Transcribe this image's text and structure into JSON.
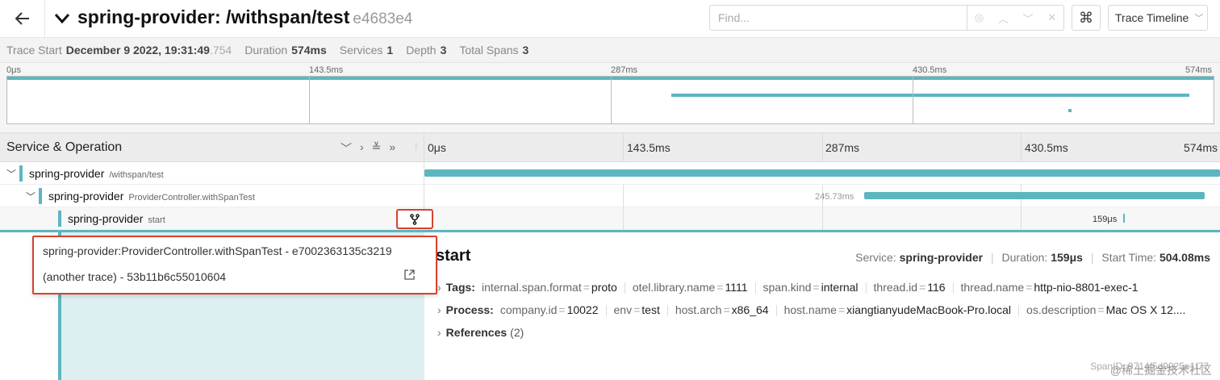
{
  "header": {
    "title": "spring-provider: /withspan/test",
    "trace_id_short": "e4683e4",
    "find_placeholder": "Find...",
    "keyboard_icon": "⌘",
    "view_select": "Trace Timeline"
  },
  "summary": {
    "trace_start_label": "Trace Start",
    "trace_start_value": "December 9 2022, 19:31:49",
    "trace_start_ms": ".754",
    "duration_label": "Duration",
    "duration_value": "574ms",
    "services_label": "Services",
    "services_value": "1",
    "depth_label": "Depth",
    "depth_value": "3",
    "total_spans_label": "Total Spans",
    "total_spans_value": "3"
  },
  "minimap": {
    "ticks": [
      "0μs",
      "143.5ms",
      "287ms",
      "430.5ms",
      "574ms"
    ]
  },
  "columns": {
    "service_op_title": "Service & Operation",
    "ticks": [
      "0μs",
      "143.5ms",
      "287ms",
      "430.5ms",
      "574ms"
    ]
  },
  "spans": [
    {
      "service": "spring-provider",
      "operation": "/withspan/test",
      "start_frac": 0.0,
      "width_frac": 1.0,
      "duration_label": ""
    },
    {
      "service": "spring-provider",
      "operation": "ProviderController.withSpanTest",
      "start_frac": 0.553,
      "width_frac": 0.428,
      "duration_label": "245.73ms"
    },
    {
      "service": "spring-provider",
      "operation": "start",
      "start_frac": 0.878,
      "width_frac": 0.002,
      "duration_label": "159μs"
    }
  ],
  "detail": {
    "operation": "start",
    "service_label": "Service:",
    "service_value": "spring-provider",
    "duration_label": "Duration:",
    "duration_value": "159μs",
    "start_label": "Start Time:",
    "start_value": "504.08ms",
    "tags_label": "Tags:",
    "tags": [
      {
        "k": "internal.span.format",
        "v": "proto"
      },
      {
        "k": "otel.library.name",
        "v": "1111"
      },
      {
        "k": "span.kind",
        "v": "internal"
      },
      {
        "k": "thread.id",
        "v": "116"
      },
      {
        "k": "thread.name",
        "v": "http-nio-8801-exec-1"
      }
    ],
    "process_label": "Process:",
    "process": [
      {
        "k": "company.id",
        "v": "10022"
      },
      {
        "k": "env",
        "v": "test"
      },
      {
        "k": "host.arch",
        "v": "x86_64"
      },
      {
        "k": "host.name",
        "v": "xiangtianyudeMacBook-Pro.local"
      },
      {
        "k": "os.description",
        "v": "Mac OS X 12...."
      }
    ],
    "references_label": "References",
    "references_count": "(2)",
    "span_id": "SpanID: 9714f5d9925e1f77"
  },
  "popover": {
    "item1": "spring-provider:ProviderController.withSpanTest - e7002363135c3219",
    "item2": "(another trace) - 53b11b6c55010604"
  },
  "watermark": "@稀土掘金技术社区",
  "colors": {
    "accent": "#5cb6bf",
    "highlight": "#d8412f",
    "detail_bg": "#ddeff1"
  }
}
